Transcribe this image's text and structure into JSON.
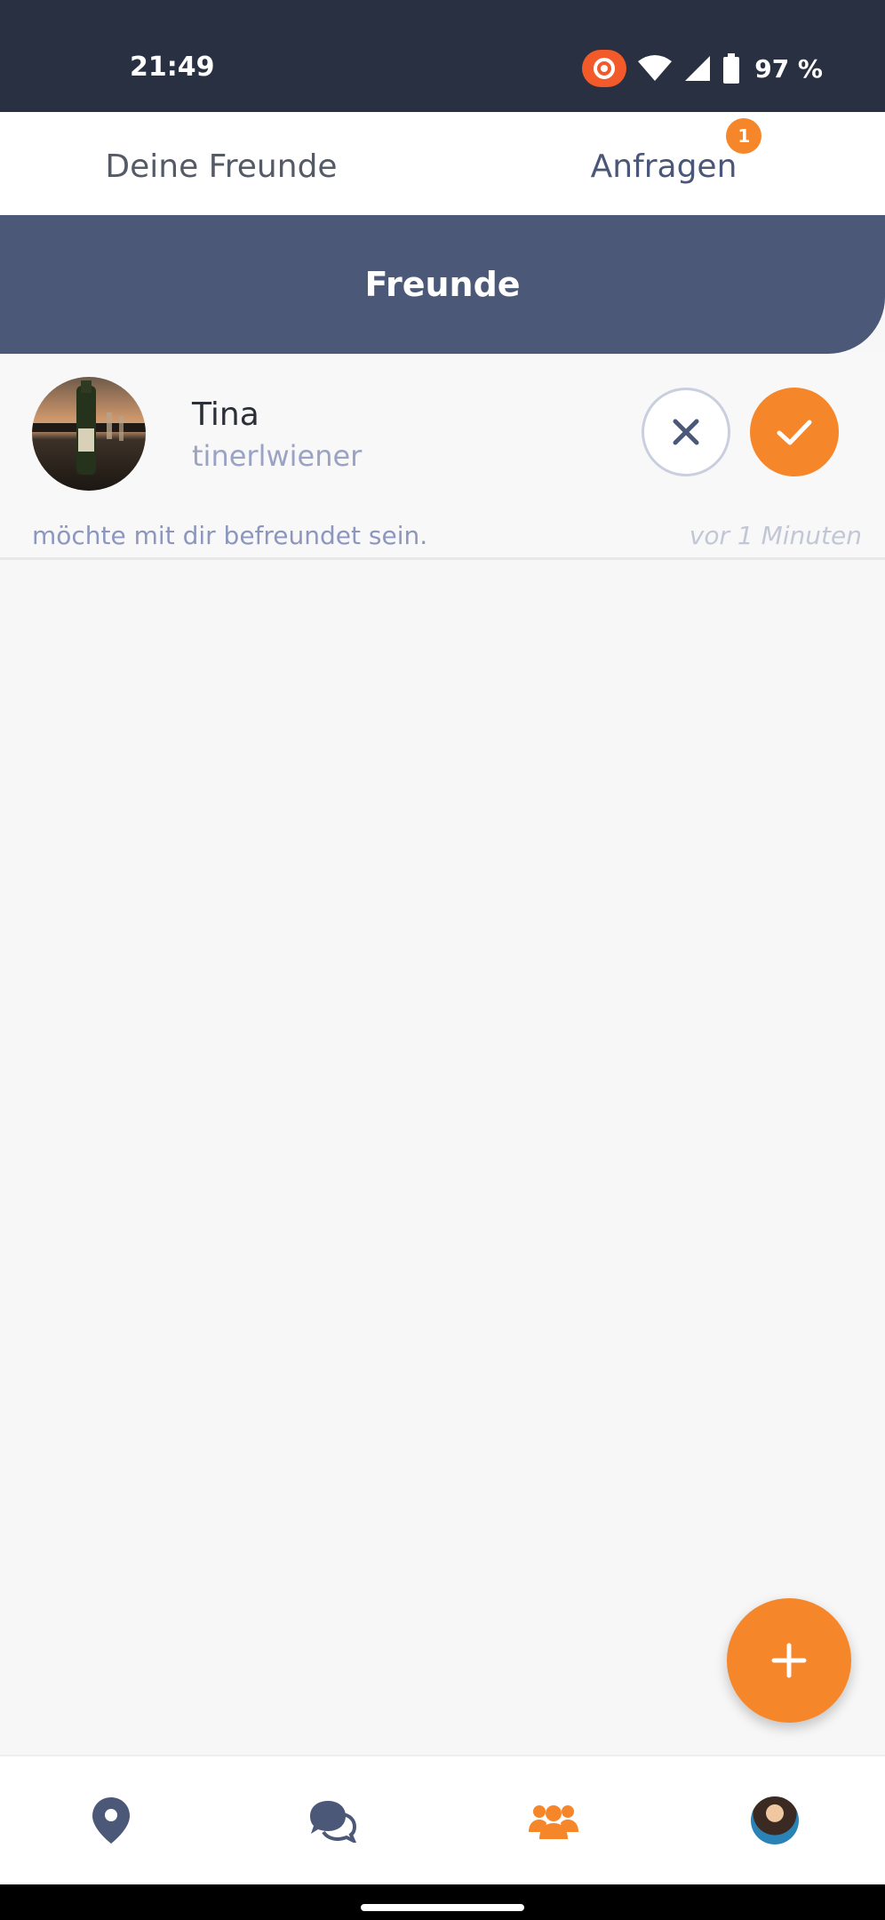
{
  "status_bar": {
    "time": "21:49",
    "battery": "97 %",
    "icons": [
      "screen-record-icon",
      "wifi-icon",
      "signal-icon",
      "battery-icon"
    ]
  },
  "tabs": [
    {
      "label": "Deine Freunde",
      "active": false
    },
    {
      "label": "Anfragen",
      "active": true,
      "badge": "1"
    }
  ],
  "section": {
    "title": "Freunde"
  },
  "requests": [
    {
      "name": "Tina",
      "handle": "tinerlwiener",
      "message": "möchte mit dir befreundet sein.",
      "time": "vor 1 Minuten"
    }
  ],
  "bottom_nav": {
    "items": [
      "map-pin-icon",
      "chat-icon",
      "friends-icon",
      "profile-avatar"
    ],
    "active": "friends-icon"
  },
  "colors": {
    "accent": "#f5862a",
    "header": "#4b5877",
    "status_bar": "#283042",
    "secondary_text": "#9aa3c4"
  }
}
